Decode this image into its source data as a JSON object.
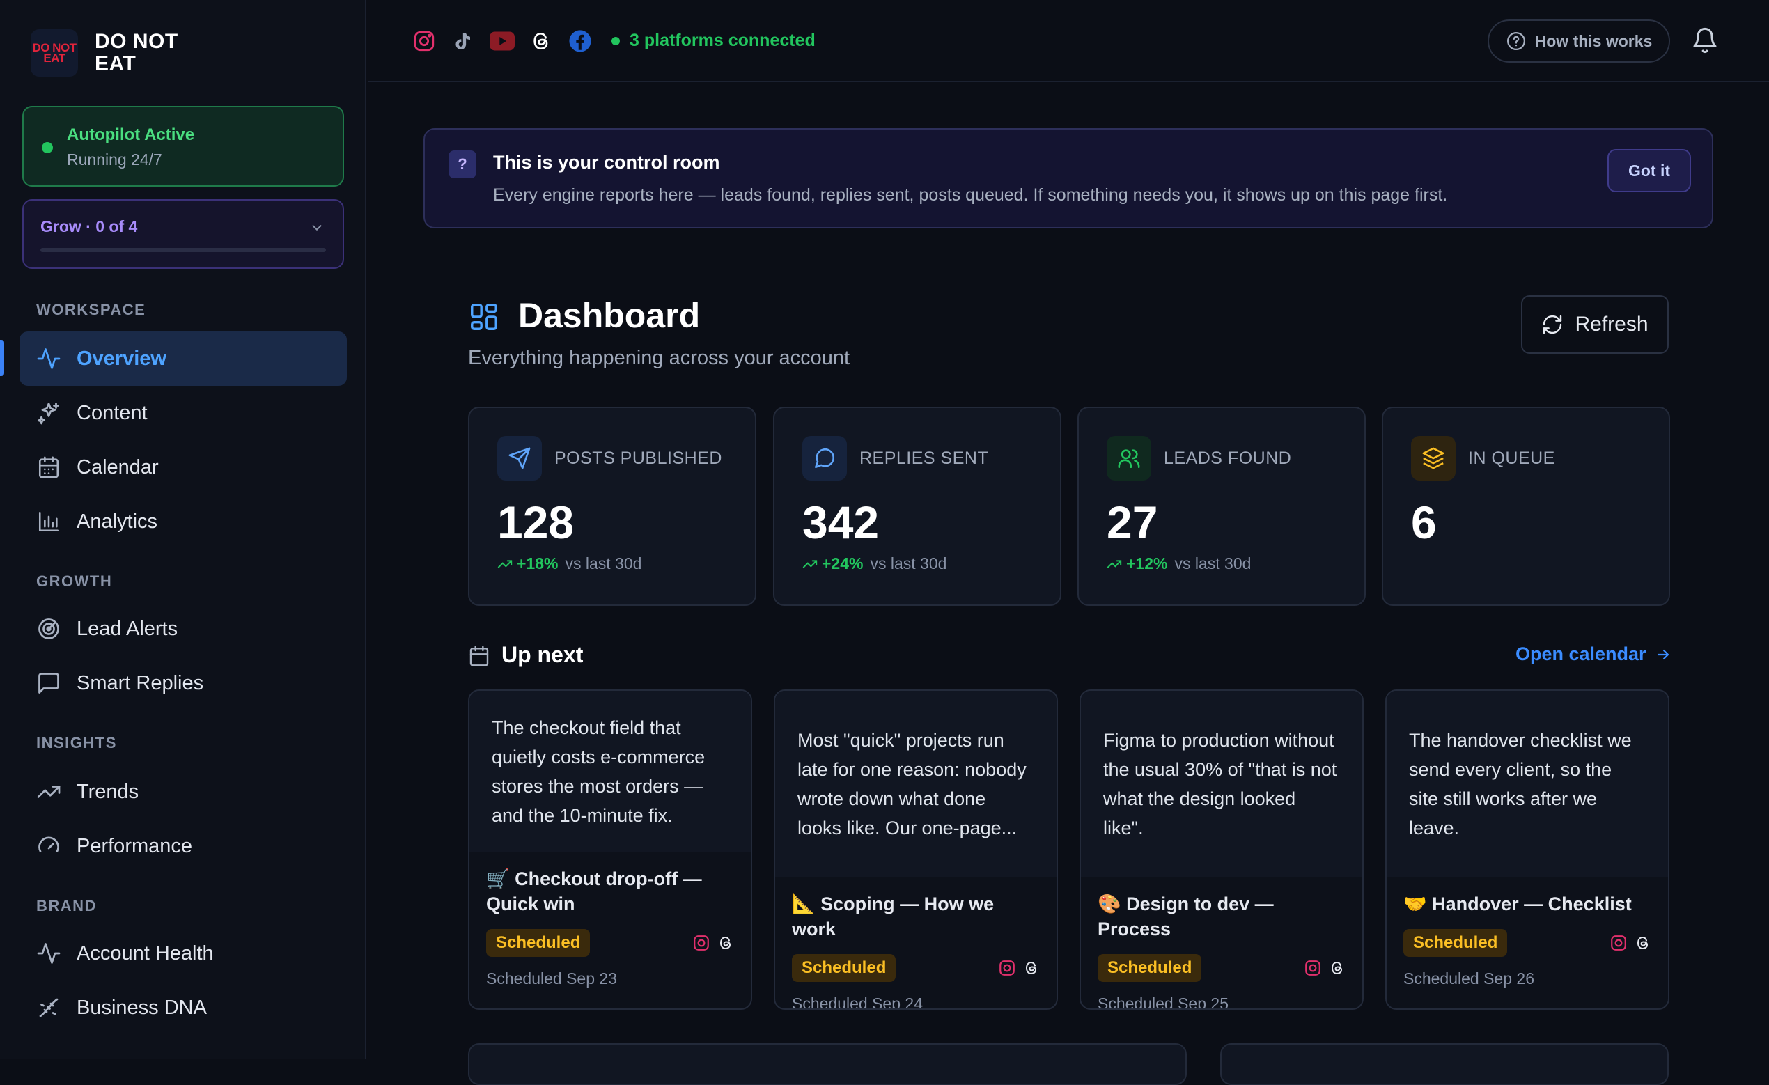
{
  "brand": {
    "logo_line1": "DO NOT",
    "logo_line2": "EAT",
    "name": "DO NOT EAT"
  },
  "autopilot": {
    "title": "Autopilot Active",
    "subtitle": "Running 24/7",
    "status_color": "#22c55e"
  },
  "grow": {
    "label": "Grow · 0 of 4",
    "progress": 0
  },
  "sidebar": {
    "sections": {
      "workspace": "WORKSPACE",
      "growth": "GROWTH",
      "insights": "INSIGHTS",
      "brand": "BRAND"
    },
    "items": [
      {
        "label": "Overview",
        "icon": "activity-icon",
        "active": true
      },
      {
        "label": "Content",
        "icon": "sparkles-icon"
      },
      {
        "label": "Calendar",
        "icon": "calendar-icon"
      },
      {
        "label": "Analytics",
        "icon": "bar-chart-icon"
      },
      {
        "label": "Lead Alerts",
        "icon": "radar-icon"
      },
      {
        "label": "Smart Replies",
        "icon": "message-square-icon"
      },
      {
        "label": "Trends",
        "icon": "trending-up-icon"
      },
      {
        "label": "Performance",
        "icon": "gauge-icon"
      },
      {
        "label": "Account Health",
        "icon": "activity-icon"
      },
      {
        "label": "Business DNA",
        "icon": "dna-icon"
      }
    ]
  },
  "topbar": {
    "platforms": [
      "instagram-icon",
      "tiktok-icon",
      "youtube-icon",
      "threads-icon",
      "facebook-icon"
    ],
    "connected": "3 platforms connected",
    "how": "How this works"
  },
  "banner": {
    "title": "This is your control room",
    "body": "Every engine reports here — leads found, replies sent, posts queued. If something needs you, it shows up on this page first.",
    "button": "Got it"
  },
  "dashboard": {
    "title": "Dashboard",
    "subtitle": "Everything happening across your account",
    "refresh": "Refresh",
    "stats": [
      {
        "label": "POSTS PUBLISHED",
        "value": "128",
        "delta": "+18%",
        "vs": "vs last 30d",
        "icon": "send-icon",
        "color": "#60a5fa"
      },
      {
        "label": "REPLIES SENT",
        "value": "342",
        "delta": "+24%",
        "vs": "vs last 30d",
        "icon": "message-circle-icon",
        "color": "#60a5fa"
      },
      {
        "label": "LEADS FOUND",
        "value": "27",
        "delta": "+12%",
        "vs": "vs last 30d",
        "icon": "users-icon",
        "color": "#22c55e"
      },
      {
        "label": "IN QUEUE",
        "value": "6",
        "delta": "",
        "vs": "",
        "icon": "layers-icon",
        "color": "#fbbf24"
      }
    ]
  },
  "upnext": {
    "title": "Up next",
    "link": "Open calendar",
    "cards": [
      {
        "text": "The checkout field that quietly costs e-commerce stores the most orders — and the 10-minute fix.",
        "emoji": "🛒",
        "title": "Checkout drop-off — Quick win",
        "status": "Scheduled",
        "date": "Scheduled Sep 23"
      },
      {
        "text": "Most \"quick\" projects run late for one reason: nobody wrote down what done looks like. Our one-page...",
        "emoji": "📐",
        "title": "Scoping — How we work",
        "status": "Scheduled",
        "date": "Scheduled Sep 24"
      },
      {
        "text": "Figma to production without the usual 30% of \"that is not what the design looked like\".",
        "emoji": "🎨",
        "title": "Design to dev — Process",
        "status": "Scheduled",
        "date": "Scheduled Sep 25"
      },
      {
        "text": "The handover checklist we send every client, so the site still works after we leave.",
        "emoji": "🤝",
        "title": "Handover — Checklist",
        "status": "Scheduled",
        "date": "Scheduled Sep 26"
      }
    ]
  }
}
